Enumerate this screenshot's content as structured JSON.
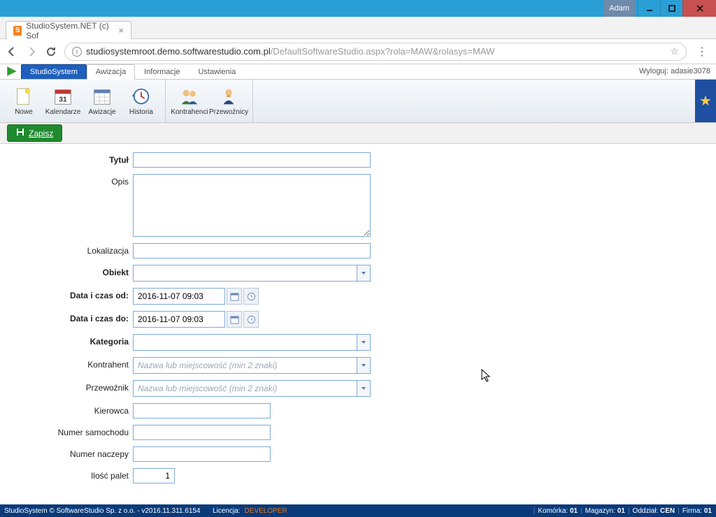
{
  "window": {
    "user": "Adam",
    "tab_title": "StudioSystem.NET (c) Sof"
  },
  "url": {
    "host": "studiosystemroot.demo.softwarestudio.com.pl",
    "path": "/DefaultSoftwareStudio.aspx?rola=MAW&rolasys=MAW"
  },
  "apptabs": {
    "primary": "StudioSystem",
    "active": "Awizacja",
    "t2": "Informacje",
    "t3": "Ustawienia",
    "logout": "Wyloguj: adasie3078"
  },
  "ribbon": {
    "nowe": "Nowe",
    "kalendarze": "Kalendarze",
    "awizacje": "Awizacje",
    "historia": "Historia",
    "kontrahenci": "Kontrahenci",
    "przewoznicy": "Przewoźnicy"
  },
  "savebar": {
    "save": "Zapisz"
  },
  "form": {
    "tytul_label": "Tytuł",
    "opis_label": "Opis",
    "lokalizacja_label": "Lokalizacja",
    "obiekt_label": "Obiekt",
    "data_od_label": "Data i czas od:",
    "data_do_label": "Data i czas do:",
    "kategoria_label": "Kategoria",
    "kontrahent_label": "Kontrahent",
    "przewoznik_label": "Przewoźnik",
    "kierowca_label": "Kierowca",
    "numer_samochodu_label": "Numer samochodu",
    "numer_naczepy_label": "Numer naczepy",
    "ilosc_palet_label": "Ilość palet",
    "data_od_value": "2016-11-07 09:03",
    "data_do_value": "2016-11-07 09:03",
    "kontrahent_placeholder": "Nazwa lub miejscowość (min 2 znaki)",
    "przewoznik_placeholder": "Nazwa lub miejscowość (min 2 znaki)",
    "ilosc_palet_value": "1"
  },
  "status": {
    "copyright": "StudioSystem © SoftwareStudio Sp. z o.o. - v2016.11.311.6154",
    "licencja_label": "Licencja:",
    "licencja_value": "DEVELOPER",
    "komorka_label": "Komórka:",
    "komorka_value": "01",
    "magazyn_label": "Magazyn:",
    "magazyn_value": "01",
    "oddzial_label": "Oddział:",
    "oddzial_value": "CEN",
    "firma_label": "Firma:",
    "firma_value": "01"
  }
}
